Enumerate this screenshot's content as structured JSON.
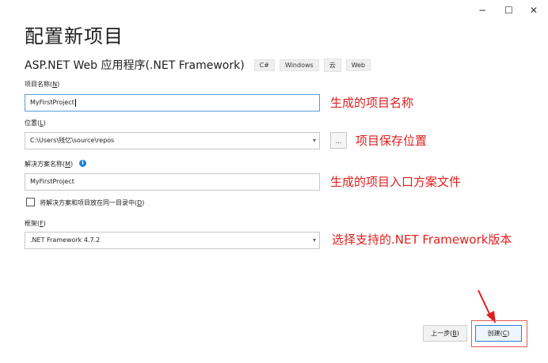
{
  "window": {
    "minimize_label": "−",
    "maximize_label": "☐",
    "close_label": "✕"
  },
  "title": "配置新项目",
  "subtitle": "ASP.NET Web 应用程序(.NET Framework)",
  "tags": [
    "C#",
    "Windows",
    "云",
    "Web"
  ],
  "fields": {
    "project_name": {
      "label": "项目名称",
      "hotkey": "N",
      "value": "MyFirstProject"
    },
    "location": {
      "label": "位置",
      "hotkey": "L",
      "value": "C:\\Users\\残忆\\source\\repos"
    },
    "solution_name": {
      "label": "解决方案名称",
      "hotkey": "M",
      "value": "MyFirstProject"
    },
    "framework": {
      "label": "框架",
      "hotkey": "F",
      "value": ".NET Framework 4.7.2"
    }
  },
  "checkbox": {
    "label": "将解决方案和项目放在同一目录中",
    "hotkey": "D",
    "checked": false
  },
  "browse_label": "...",
  "info_icon_glyph": "i",
  "annotations": {
    "project_name": "生成的项目名称",
    "location": "项目保存位置",
    "solution_name": "生成的项目入口方案文件",
    "framework": "选择支持的.NET Framework版本"
  },
  "buttons": {
    "back": {
      "label": "上一步",
      "hotkey": "B"
    },
    "create": {
      "label": "创建",
      "hotkey": "C"
    }
  },
  "colors": {
    "annotation": "#e02020",
    "accent": "#2b7fd6",
    "highlight_box": "#e65656"
  }
}
